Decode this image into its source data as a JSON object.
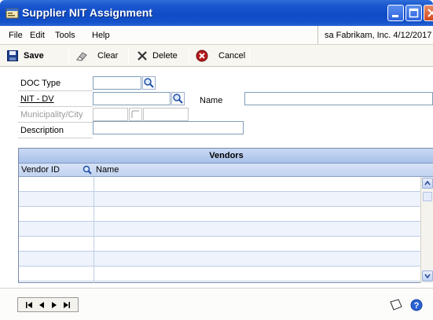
{
  "window": {
    "title": "Supplier NIT Assignment"
  },
  "menu": {
    "items": [
      {
        "label": "File"
      },
      {
        "label": "Edit"
      },
      {
        "label": "Tools"
      },
      {
        "label": "Help"
      }
    ],
    "company_info": "sa  Fabrikam, Inc.  4/12/2017"
  },
  "toolbar": {
    "save_label": "Save",
    "clear_label": "Clear",
    "delete_label": "Delete",
    "cancel_label": "Cancel"
  },
  "form": {
    "doc_type_label": "DOC Type",
    "doc_type_value": "",
    "nit_dv_label": "NIT - DV",
    "nit_dv_value": "",
    "name_label": "Name",
    "name_value": "",
    "municipality_label": "Municipality/City",
    "municipality_value": "",
    "description_label": "Description",
    "description_value": ""
  },
  "grid": {
    "title": "Vendors",
    "columns": [
      "Vendor ID",
      "Name"
    ],
    "rows": [
      [
        "",
        ""
      ],
      [
        "",
        ""
      ],
      [
        "",
        ""
      ],
      [
        "",
        ""
      ],
      [
        "",
        ""
      ],
      [
        "",
        ""
      ],
      [
        "",
        ""
      ]
    ]
  },
  "colors": {
    "titlebar": "#0f4bc6",
    "grid_header": "#c1d3f0",
    "grid_alt_row": "#eef3fc"
  }
}
